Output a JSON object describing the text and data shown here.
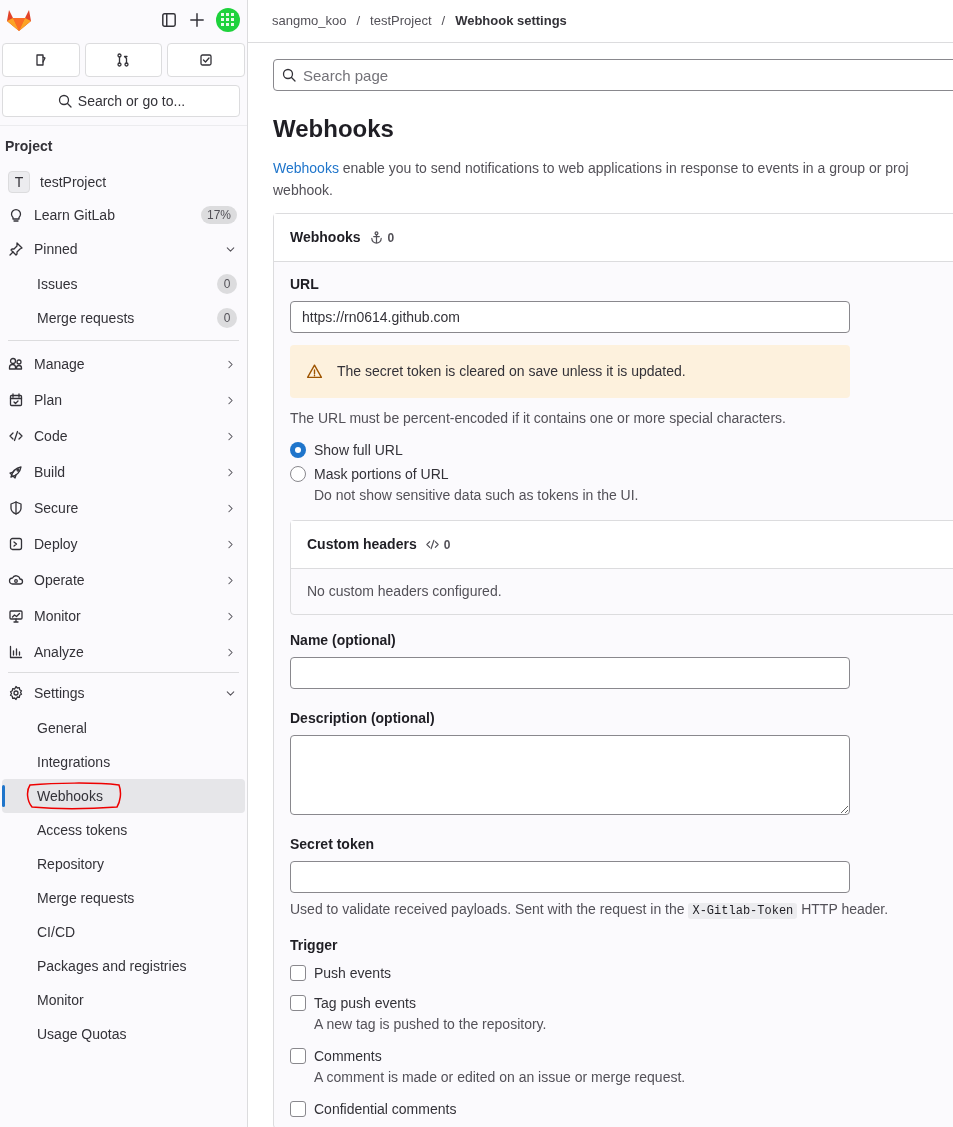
{
  "sidebar": {
    "top_buttons": [
      {
        "kind": "panel"
      },
      {
        "kind": "plus"
      }
    ],
    "quick_buttons": [
      {
        "kind": "issues"
      },
      {
        "kind": "merge"
      },
      {
        "kind": "todo"
      }
    ],
    "search": {
      "placeholder": "Search or go to..."
    },
    "section_title": "Project",
    "project": {
      "initial": "T",
      "name": "testProject"
    },
    "learn": {
      "label": "Learn GitLab",
      "badge": "17%"
    },
    "pinned": {
      "label": "Pinned",
      "expanded": true,
      "items": [
        {
          "label": "Issues",
          "count": "0"
        },
        {
          "label": "Merge requests",
          "count": "0"
        }
      ]
    },
    "menu": [
      {
        "label": "Manage",
        "expanded": false
      },
      {
        "label": "Plan",
        "expanded": false
      },
      {
        "label": "Code",
        "expanded": false
      },
      {
        "label": "Build",
        "expanded": false
      },
      {
        "label": "Secure",
        "expanded": false
      },
      {
        "label": "Deploy",
        "expanded": false
      },
      {
        "label": "Operate",
        "expanded": false
      },
      {
        "label": "Monitor",
        "expanded": false
      },
      {
        "label": "Analyze",
        "expanded": false
      }
    ],
    "settings": {
      "label": "Settings",
      "expanded": true,
      "items": [
        {
          "label": "General",
          "selected": false,
          "annotated": false
        },
        {
          "label": "Integrations",
          "selected": false,
          "annotated": false
        },
        {
          "label": "Webhooks",
          "selected": true,
          "annotated": true
        },
        {
          "label": "Access tokens",
          "selected": false,
          "annotated": false
        },
        {
          "label": "Repository",
          "selected": false,
          "annotated": false
        },
        {
          "label": "Merge requests",
          "selected": false,
          "annotated": false
        },
        {
          "label": "CI/CD",
          "selected": false,
          "annotated": false
        },
        {
          "label": "Packages and registries",
          "selected": false,
          "annotated": false
        },
        {
          "label": "Monitor",
          "selected": false,
          "annotated": false
        },
        {
          "label": "Usage Quotas",
          "selected": false,
          "annotated": false
        }
      ]
    }
  },
  "breadcrumb": [
    {
      "label": "sangmo_koo"
    },
    {
      "separator": "/",
      "label": "testProject"
    },
    {
      "separator": "/",
      "label": "Webhook settings"
    }
  ],
  "page_search": {
    "placeholder": "Search page"
  },
  "title": "Webhooks",
  "intro": {
    "link": "Webhooks",
    "line_1": " enable you to send notifications to web applications in response to events in a group or proj",
    "line_2": "webhook."
  },
  "card": {
    "title": "Webhooks",
    "count": "0",
    "url": {
      "label": "URL",
      "value": "https://rn0614.github.com"
    },
    "alert": "The secret token is cleared on save unless it is updated.",
    "url_help": "The URL must be percent-encoded if it contains one or more special characters.",
    "url_options": [
      {
        "label": "Show full URL",
        "selected": true
      },
      {
        "label": "Mask portions of URL",
        "selected": false,
        "help": "Do not show sensitive data such as tokens in the UI."
      }
    ],
    "custom_headers": {
      "title": "Custom headers",
      "count": "0",
      "empty": "No custom headers configured."
    },
    "name": {
      "label": "Name (optional)"
    },
    "description": {
      "label": "Description (optional)"
    },
    "secret": {
      "label": "Secret token",
      "help_before": "Used to validate received payloads. Sent with the request in the ",
      "code": "X-Gitlab-Token",
      "help_after": " HTTP header."
    },
    "trigger": {
      "label": "Trigger",
      "items": [
        {
          "label": "Push events",
          "checked": false
        },
        {
          "label": "Tag push events",
          "checked": false,
          "help": "A new tag is pushed to the repository."
        },
        {
          "label": "Comments",
          "checked": false,
          "help": "A comment is made or edited on an issue or merge request."
        },
        {
          "label": "Confidential comments",
          "checked": false
        }
      ]
    }
  }
}
